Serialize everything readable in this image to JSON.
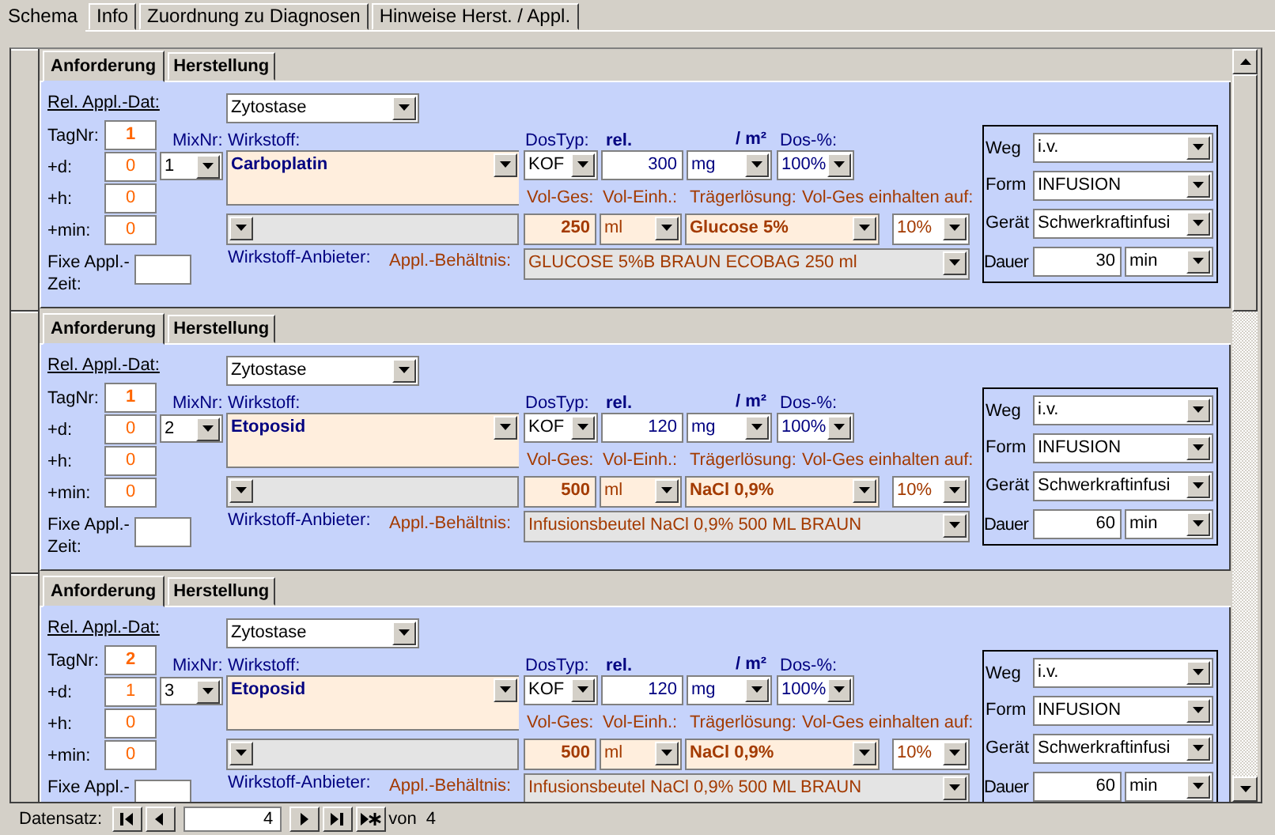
{
  "tabs": [
    {
      "label": "Schema",
      "selected": true
    },
    {
      "label": "Info",
      "selected": false
    },
    {
      "label": "Zuordnung zu Diagnosen",
      "selected": false
    },
    {
      "label": "Hinweise Herst. / Appl.",
      "selected": false
    }
  ],
  "records": [
    {
      "subtabs": [
        {
          "label": "Anforderung",
          "selected": true
        },
        {
          "label": "Herstellung",
          "selected": false
        }
      ],
      "rel_appl_dat_label": "Rel. Appl.-Dat:",
      "category": "Zytostase",
      "tagnr_label": "TagNr:",
      "tagnr": "1",
      "d_label": "+d:",
      "d": "0",
      "h_label": "+h:",
      "h": "0",
      "min_label": "+min:",
      "min": "0",
      "fixe_label": [
        "Fixe Appl.-",
        "Zeit:"
      ],
      "mixnr_label": "MixNr:",
      "mixnr": "1",
      "wirkstoff_label": "Wirkstoff:",
      "wirkstoff": "Carboplatin",
      "anbieter_label": "Wirkstoff-Anbieter:",
      "dostyp_label": "DosTyp:",
      "dostyp": "KOF",
      "rel_label": "rel.",
      "dose": "300",
      "dose_unit": "mg",
      "per_label": "/ m²",
      "dos_pct_label": "Dos-%:",
      "dos_pct": "100%",
      "vol_ges_label": "Vol-Ges:",
      "vol_ges": "250",
      "vol_einh_label": "Vol-Einh.:",
      "vol_einh": "ml",
      "traeger_label": "Trägerlösung:",
      "traeger": "Glucose 5%",
      "einhalten_label": "Vol-Ges einhalten auf:",
      "einhalten": "10%",
      "behaeltnis_label": "Appl.-Behältnis:",
      "behaeltnis": "GLUCOSE 5%B BRAUN ECOBAG 250 ml",
      "weg_label": "Weg",
      "weg": "i.v.",
      "form_label": "Form",
      "form": "INFUSION",
      "geraet_label": "Gerät",
      "geraet": "Schwerkraftinfusi",
      "dauer_label": "Dauer",
      "dauer": "30",
      "dauer_unit": "min"
    },
    {
      "subtabs": [
        {
          "label": "Anforderung",
          "selected": true
        },
        {
          "label": "Herstellung",
          "selected": false
        }
      ],
      "rel_appl_dat_label": "Rel. Appl.-Dat:",
      "category": "Zytostase",
      "tagnr_label": "TagNr:",
      "tagnr": "1",
      "d_label": "+d:",
      "d": "0",
      "h_label": "+h:",
      "h": "0",
      "min_label": "+min:",
      "min": "0",
      "fixe_label": [
        "Fixe Appl.-",
        "Zeit:"
      ],
      "mixnr_label": "MixNr:",
      "mixnr": "2",
      "wirkstoff_label": "Wirkstoff:",
      "wirkstoff": "Etoposid",
      "anbieter_label": "Wirkstoff-Anbieter:",
      "dostyp_label": "DosTyp:",
      "dostyp": "KOF",
      "rel_label": "rel.",
      "dose": "120",
      "dose_unit": "mg",
      "per_label": "/ m²",
      "dos_pct_label": "Dos-%:",
      "dos_pct": "100%",
      "vol_ges_label": "Vol-Ges:",
      "vol_ges": "500",
      "vol_einh_label": "Vol-Einh.:",
      "vol_einh": "ml",
      "traeger_label": "Trägerlösung:",
      "traeger": "NaCl 0,9%",
      "einhalten_label": "Vol-Ges einhalten auf:",
      "einhalten": "10%",
      "behaeltnis_label": "Appl.-Behältnis:",
      "behaeltnis": "Infusionsbeutel NaCl 0,9% 500 ML BRAUN",
      "weg_label": "Weg",
      "weg": "i.v.",
      "form_label": "Form",
      "form": "INFUSION",
      "geraet_label": "Gerät",
      "geraet": "Schwerkraftinfusi",
      "dauer_label": "Dauer",
      "dauer": "60",
      "dauer_unit": "min"
    },
    {
      "subtabs": [
        {
          "label": "Anforderung",
          "selected": true
        },
        {
          "label": "Herstellung",
          "selected": false
        }
      ],
      "rel_appl_dat_label": "Rel. Appl.-Dat:",
      "category": "Zytostase",
      "tagnr_label": "TagNr:",
      "tagnr": "2",
      "d_label": "+d:",
      "d": "1",
      "h_label": "+h:",
      "h": "0",
      "min_label": "+min:",
      "min": "0",
      "fixe_label": [
        "Fixe Appl.-"
      ],
      "mixnr_label": "MixNr:",
      "mixnr": "3",
      "wirkstoff_label": "Wirkstoff:",
      "wirkstoff": "Etoposid",
      "anbieter_label": "Wirkstoff-Anbieter:",
      "dostyp_label": "DosTyp:",
      "dostyp": "KOF",
      "rel_label": "rel.",
      "dose": "120",
      "dose_unit": "mg",
      "per_label": "/ m²",
      "dos_pct_label": "Dos-%:",
      "dos_pct": "100%",
      "vol_ges_label": "Vol-Ges:",
      "vol_ges": "500",
      "vol_einh_label": "Vol-Einh.:",
      "vol_einh": "ml",
      "traeger_label": "Trägerlösung:",
      "traeger": "NaCl 0,9%",
      "einhalten_label": "Vol-Ges einhalten auf:",
      "einhalten": "10%",
      "behaeltnis_label": "Appl.-Behältnis:",
      "behaeltnis": "Infusionsbeutel NaCl 0,9% 500 ML BRAUN",
      "weg_label": "Weg",
      "weg": "i.v.",
      "form_label": "Form",
      "form": "INFUSION",
      "geraet_label": "Gerät",
      "geraet": "Schwerkraftinfusi",
      "dauer_label": "Dauer",
      "dauer": "60",
      "dauer_unit": "min"
    }
  ],
  "navigation": {
    "label": "Datensatz:",
    "current": "4",
    "total_label": "von",
    "total": "4"
  }
}
